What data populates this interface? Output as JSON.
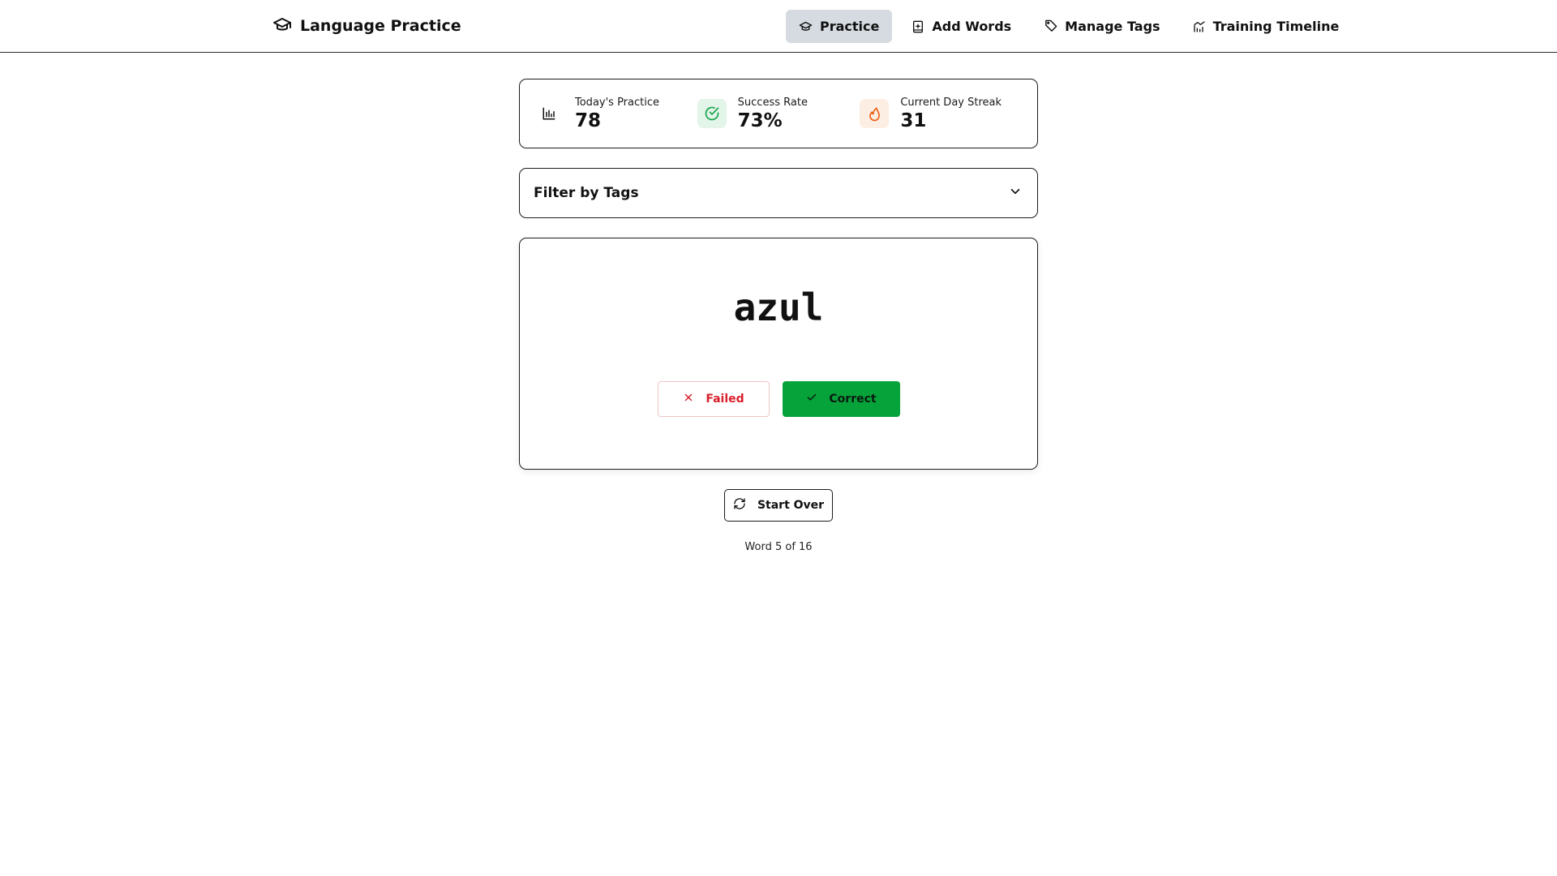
{
  "app": {
    "title": "Language Practice",
    "icon": "graduation-cap-icon"
  },
  "nav": {
    "items": [
      {
        "label": "Practice",
        "icon": "graduation-cap-icon",
        "active": true
      },
      {
        "label": "Add Words",
        "icon": "book-plus-icon",
        "active": false
      },
      {
        "label": "Manage Tags",
        "icon": "tag-icon",
        "active": false
      },
      {
        "label": "Training Timeline",
        "icon": "chart-line-icon",
        "active": false
      }
    ]
  },
  "stats": {
    "today": {
      "label": "Today's Practice",
      "value": "78",
      "icon": "bar-chart-icon"
    },
    "success": {
      "label": "Success Rate",
      "value": "73%",
      "icon": "check-circle-icon"
    },
    "streak": {
      "label": "Current Day Streak",
      "value": "31",
      "icon": "flame-icon"
    }
  },
  "filter": {
    "title": "Filter by Tags",
    "icon": "chevron-down-icon"
  },
  "card": {
    "word": "azul",
    "failed_label": "Failed",
    "correct_label": "Correct"
  },
  "controls": {
    "start_over_label": "Start Over",
    "progress_text": "Word 5 of 16"
  },
  "colors": {
    "accent_active_nav": "#d6dbe1",
    "success_green": "#05a33a",
    "failed_red": "#d81f2b",
    "streak_orange": "#ea580c"
  }
}
